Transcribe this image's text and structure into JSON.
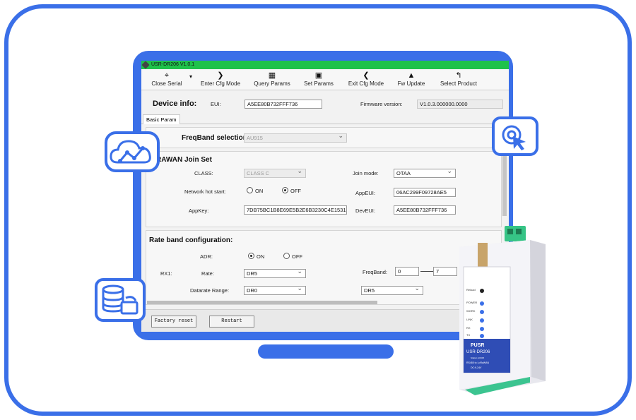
{
  "window": {
    "title": "USR-DR206 V1.0.1"
  },
  "toolbar": {
    "close_serial": "Close Serial",
    "enter_cfg": "Enter Cfg Mode",
    "query_params": "Query Params",
    "set_params": "Set Params",
    "exit_cfg": "Exit Cfg Mode",
    "fw_update": "Fw Update",
    "select_product": "Select Product"
  },
  "device_info": {
    "title": "Device info:",
    "eui_label": "EUI:",
    "eui_value": "A5EE80B732FFF736",
    "fw_label": "Firmware version:",
    "fw_value": "V1.0.3.000000.0000"
  },
  "tabs": {
    "basic": "Basic Param"
  },
  "freqband": {
    "label": "FreqBand selection",
    "value": "AU915"
  },
  "join": {
    "title": "RAWAN Join Set",
    "class_label": "CLASS:",
    "class_value": "CLASS C",
    "join_mode_label": "Join mode:",
    "join_mode_value": "OTAA",
    "hot_start_label": "Network hot start:",
    "on": "ON",
    "off": "OFF",
    "appeui_label": "AppEUI:",
    "appeui_value": "06AC299F09728AE5",
    "appkey_label": "AppKey:",
    "appkey_value": "7DB75BC1B8E69E5B2E6B3230C4E15315",
    "deveui_label": "DevEUI:",
    "deveui_value": "A5EE80B732FFF736"
  },
  "rate": {
    "title": "Rate band configuration:",
    "adr_label": "ADR:",
    "on": "ON",
    "off": "OFF",
    "rx1_label": "RX1:",
    "rate_label": "Rate:",
    "rate_value": "DR5",
    "freqband_label": "FreqBand:",
    "freq_from": "0",
    "freq_to": "7",
    "datarate_label": "Datarate Range:",
    "datarate_min": "DR0",
    "datarate_max": "DR5"
  },
  "bottom": {
    "factory_reset": "Factory reset",
    "restart": "Restart"
  },
  "device": {
    "brand": "PUSR",
    "model": "USR-DR206",
    "sub": "Station AU915",
    "desc": "RS485 to LoRaWAN",
    "power": "DC:9-24V",
    "leds": [
      "Reload",
      "POWER",
      "WORK",
      "LINK",
      "RX",
      "TX"
    ]
  },
  "colors": {
    "accent": "#3a6fe8",
    "titlebar": "#1ec24a"
  }
}
